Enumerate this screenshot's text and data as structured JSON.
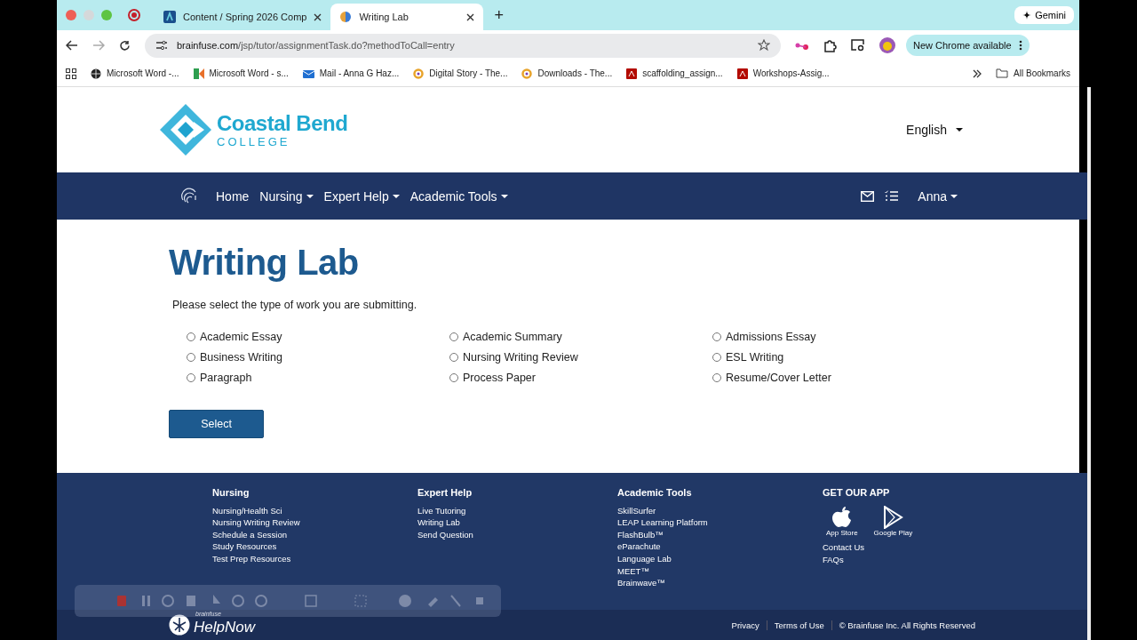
{
  "browser": {
    "tabs": [
      {
        "title": "Content / Spring 2026 Comp",
        "selected": false,
        "kind": "d2l"
      },
      {
        "title": "Writing Lab",
        "selected": true,
        "kind": "brainfuse"
      }
    ],
    "new_tab": "+",
    "gemini": "Gemini",
    "url_host": "brainfuse.com",
    "url_path": "/jsp/tutor/assignmentTask.do?methodToCall=entry",
    "update": "New Chrome available",
    "bookmarks": [
      {
        "title": "Microsoft Word -...",
        "kind": "globe"
      },
      {
        "title": "Microsoft Word - s...",
        "kind": "k"
      },
      {
        "title": "Mail - Anna G Haz...",
        "kind": "mail"
      },
      {
        "title": "Digital Story - The...",
        "kind": "ring"
      },
      {
        "title": "Downloads - The...",
        "kind": "ring"
      },
      {
        "title": "scaffolding_assign...",
        "kind": "pdf"
      },
      {
        "title": "Workshops-Assig...",
        "kind": "pdf"
      }
    ],
    "all_bookmarks": "All Bookmarks"
  },
  "header": {
    "logo_name": "Coastal Bend",
    "logo_sub": "COLLEGE",
    "language": "English"
  },
  "nav": {
    "items": [
      {
        "label": "Home",
        "dropdown": false
      },
      {
        "label": "Nursing",
        "dropdown": true
      },
      {
        "label": "Expert Help",
        "dropdown": true
      },
      {
        "label": "Academic Tools",
        "dropdown": true
      }
    ],
    "user": "Anna"
  },
  "main": {
    "title": "Writing Lab",
    "prompt": "Please select the type of work you are submitting.",
    "options": [
      {
        "label": "Academic Essay",
        "selected": false
      },
      {
        "label": "Academic Summary",
        "selected": false
      },
      {
        "label": "Admissions Essay",
        "selected": false
      },
      {
        "label": "Business Writing",
        "selected": false
      },
      {
        "label": "Nursing Writing Review",
        "selected": false
      },
      {
        "label": "ESL Writing",
        "selected": false
      },
      {
        "label": "Paragraph",
        "selected": false
      },
      {
        "label": "Process Paper",
        "selected": false
      },
      {
        "label": "Resume/Cover Letter",
        "selected": false
      }
    ],
    "button": "Select"
  },
  "footer": {
    "columns": [
      {
        "heading": "Nursing",
        "links": [
          "Nursing/Health Sci",
          "Nursing Writing Review",
          "Schedule a Session",
          "Study Resources",
          "Test Prep Resources"
        ]
      },
      {
        "heading": "Expert Help",
        "links": [
          "Live Tutoring",
          "Writing Lab",
          "Send Question"
        ]
      },
      {
        "heading": "Academic Tools",
        "links": [
          "SkillSurfer",
          "LEAP Learning Platform",
          "FlashBulb™",
          "eParachute",
          "Language Lab",
          "MEET™",
          "Brainwave™"
        ]
      }
    ],
    "app": {
      "heading": "GET OUR APP",
      "stores": [
        {
          "name": "App Store",
          "kind": "apple"
        },
        {
          "name": "Google Play",
          "kind": "play"
        }
      ],
      "links": [
        "Contact Us",
        "FAQs"
      ]
    },
    "brand_small": "brainfuse",
    "brand": "HelpNow",
    "bottom_links": [
      "Privacy",
      "Terms of Use"
    ],
    "copyright": "© Brainfuse Inc. All Rights Reserved"
  }
}
